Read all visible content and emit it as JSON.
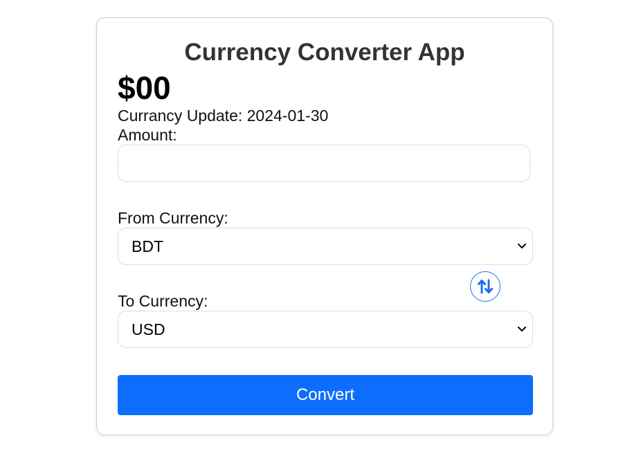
{
  "app": {
    "title": "Currency Converter App",
    "result": "$00",
    "update_text": "Currancy Update: 2024-01-30"
  },
  "form": {
    "amount_label": "Amount:",
    "amount_value": "",
    "from_label": "From Currency:",
    "from_value": "BDT",
    "to_label": "To Currency:",
    "to_value": "USD",
    "convert_label": "Convert"
  },
  "icons": {
    "swap": "swap-vertical-arrows-icon",
    "dropdown": "chevron-down-icon"
  },
  "colors": {
    "accent": "#0d6efd",
    "swap_icon": "#1a6fe8",
    "title": "#333333"
  }
}
